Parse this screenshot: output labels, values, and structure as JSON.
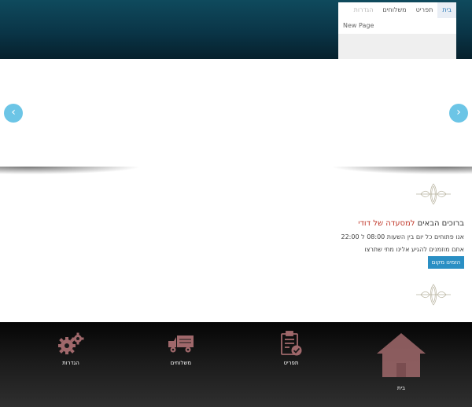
{
  "menu": {
    "tabs": [
      {
        "label": "בית",
        "active": true
      },
      {
        "label": "תפריט",
        "active": false
      },
      {
        "label": "משלוחים",
        "active": false
      },
      {
        "label": "הגדרות",
        "active": false,
        "faded": true
      }
    ],
    "new_page": "New Page"
  },
  "slider": {
    "prev_arrow": "‹",
    "next_arrow": "›"
  },
  "welcome": {
    "greeting": "ברוכים הבאים ",
    "place": "למסעדה של דודי"
  },
  "hours_text": "אנו פתוחים כל יום בין השעות 08:00 ל 22:00",
  "invite_text": "אתם מוזמנים להגיע אלינו מתי שתרצו",
  "order_button": "הזמינו מקום",
  "bottom_nav": {
    "home": "בית",
    "menu": "תפריט",
    "delivery": "משלוחים",
    "settings": "הגדרות"
  },
  "colors": {
    "accent": "#c0392b",
    "button": "#2a8fc4",
    "arrow": "#6cc5e6",
    "icon": "#a0686b"
  }
}
